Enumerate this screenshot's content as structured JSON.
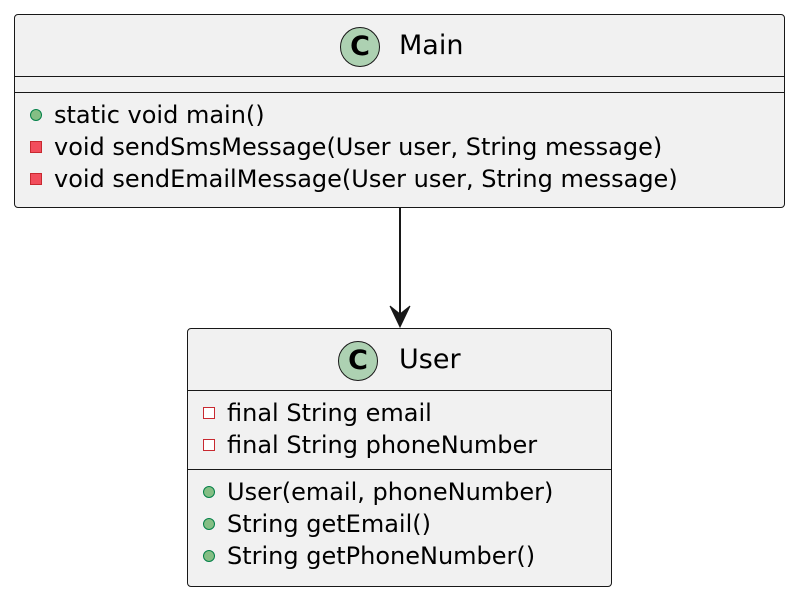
{
  "diagram": {
    "classes": [
      {
        "name": "Main",
        "badge": "C",
        "fields": [],
        "methods": [
          {
            "visibility": "public",
            "text": "static void main()"
          },
          {
            "visibility": "private",
            "text": "void sendSmsMessage(User user, String message)"
          },
          {
            "visibility": "private",
            "text": "void sendEmailMessage(User user, String message)"
          }
        ]
      },
      {
        "name": "User",
        "badge": "C",
        "fields": [
          {
            "visibility": "private",
            "text": "final String email"
          },
          {
            "visibility": "private",
            "text": "final String phoneNumber"
          }
        ],
        "methods": [
          {
            "visibility": "public",
            "text": "User(email, phoneNumber)"
          },
          {
            "visibility": "public",
            "text": "String getEmail()"
          },
          {
            "visibility": "public",
            "text": "String getPhoneNumber()"
          }
        ]
      }
    ],
    "relations": [
      {
        "from": "Main",
        "to": "User",
        "type": "association"
      }
    ],
    "colors": {
      "box_fill": "#f1f1f1",
      "border": "#181818",
      "badge_fill": "#add1b2",
      "public_method": "#84be84",
      "private_method": "#f24d5c",
      "private_field_border": "#c82930"
    }
  }
}
